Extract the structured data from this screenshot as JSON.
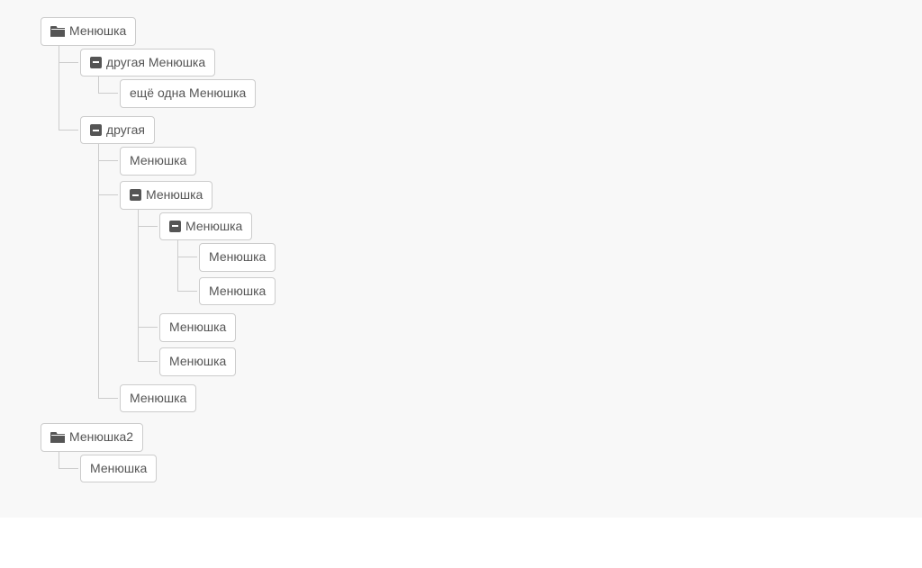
{
  "tree": [
    {
      "icon": "folder-open",
      "label": "Менюшка",
      "children": [
        {
          "icon": "minus",
          "label": "другая Менюшка",
          "children": [
            {
              "icon": null,
              "label": "ещё одна Менюшка",
              "children": []
            }
          ]
        },
        {
          "icon": "minus",
          "label": "другая",
          "children": [
            {
              "icon": null,
              "label": "Менюшка",
              "children": []
            },
            {
              "icon": "minus",
              "label": "Менюшка",
              "children": [
                {
                  "icon": "minus",
                  "label": "Менюшка",
                  "children": [
                    {
                      "icon": null,
                      "label": "Менюшка",
                      "children": []
                    },
                    {
                      "icon": null,
                      "label": "Менюшка",
                      "children": []
                    }
                  ]
                },
                {
                  "icon": null,
                  "label": "Менюшка",
                  "children": []
                },
                {
                  "icon": null,
                  "label": "Менюшка",
                  "children": []
                }
              ]
            },
            {
              "icon": null,
              "label": "Менюшка",
              "children": []
            }
          ]
        }
      ]
    },
    {
      "icon": "folder-open",
      "label": "Менюшка2",
      "children": [
        {
          "icon": null,
          "label": "Менюшка",
          "children": []
        }
      ]
    }
  ]
}
